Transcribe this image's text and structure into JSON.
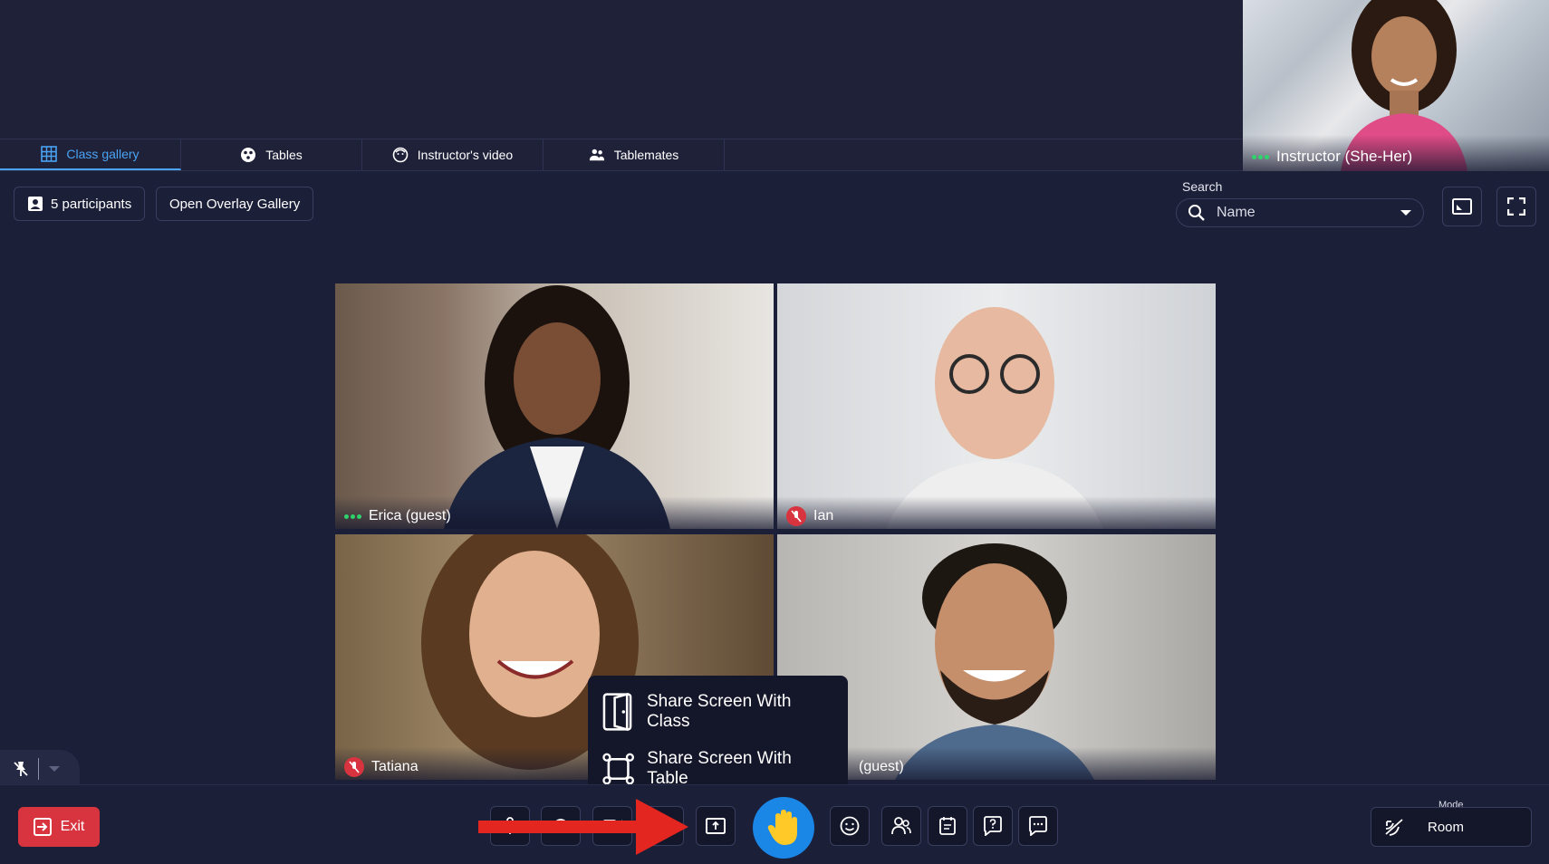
{
  "tabs": [
    {
      "label": "Class gallery",
      "icon": "grid-icon",
      "active": true
    },
    {
      "label": "Tables",
      "icon": "tables-icon"
    },
    {
      "label": "Instructor's video",
      "icon": "instructor-video-icon"
    },
    {
      "label": "Tablemates",
      "icon": "people-icon"
    }
  ],
  "instructor": {
    "name": "Instructor (She-Her)"
  },
  "toolbar": {
    "participants_label": "5 participants",
    "overlay_label": "Open Overlay Gallery",
    "search_label": "Search",
    "search_value": "Name"
  },
  "participants": [
    {
      "name": "Erica (guest)",
      "status": "live"
    },
    {
      "name": "Ian",
      "status": "muted"
    },
    {
      "name": "Tatiana",
      "status": "muted"
    },
    {
      "name": "(guest)",
      "status": "live"
    }
  ],
  "share_menu": {
    "class_label": "Share Screen With Class",
    "table_label": "Share Screen With Table"
  },
  "bottom": {
    "exit_label": "Exit",
    "mode_label": "Mode",
    "mode_value": "Room"
  },
  "colors": {
    "accent": "#4aa3f5",
    "danger": "#d8343f",
    "hand": "#1a86e6",
    "background": "#1c1f38"
  }
}
